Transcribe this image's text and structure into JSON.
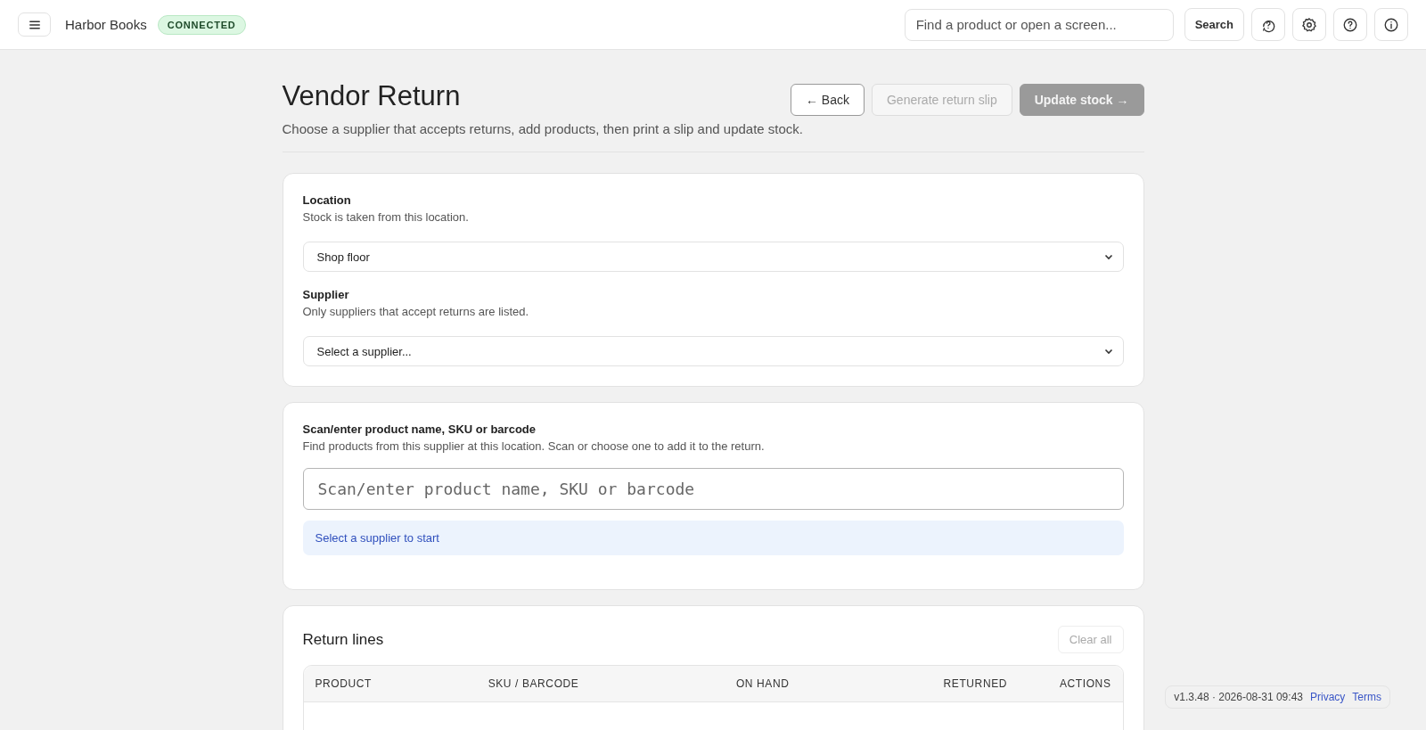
{
  "top_bar": {
    "app_name": "Harbor Books",
    "status_badge": "CONNECTED",
    "search": {
      "placeholder": "Find a product or open a screen..."
    },
    "search_button": "Search"
  },
  "page": {
    "title": "Vendor Return",
    "subtitle": "Choose a supplier that accepts returns, add products, then print a slip and update stock.",
    "actions": [
      {
        "label": "← Back",
        "kind": "outline",
        "disabled": false
      },
      {
        "label": "Generate return slip",
        "kind": "outline",
        "disabled": true
      },
      {
        "label": "Update stock →",
        "kind": "primary",
        "disabled": true
      }
    ]
  },
  "selection_card": {
    "fields": [
      {
        "label": "Location",
        "hint": "Stock is taken from this location.",
        "value": "Shop floor"
      },
      {
        "label": "Supplier",
        "hint": "Only suppliers that accept returns are listed.",
        "placeholder": "Select a supplier..."
      }
    ]
  },
  "product_card": {
    "label": "Scan/enter product name, SKU or barcode",
    "hint": "Find products from this supplier at this location. Scan or choose one to add it to the return.",
    "search": {
      "placeholder": "Scan/enter product name, SKU or barcode"
    },
    "notice": "Select a supplier to start"
  },
  "return_lines": {
    "title": "Return lines",
    "clear_button": {
      "label": "Clear all",
      "disabled": true
    },
    "table": {
      "columns": [
        "PRODUCT",
        "SKU / BARCODE",
        "ON HAND",
        "RETURNED",
        "ACTIONS"
      ]
    }
  },
  "footer": {
    "version": "v1.3.48 · 2026-08-31 09:43",
    "links": [
      "Privacy",
      "Terms"
    ]
  }
}
